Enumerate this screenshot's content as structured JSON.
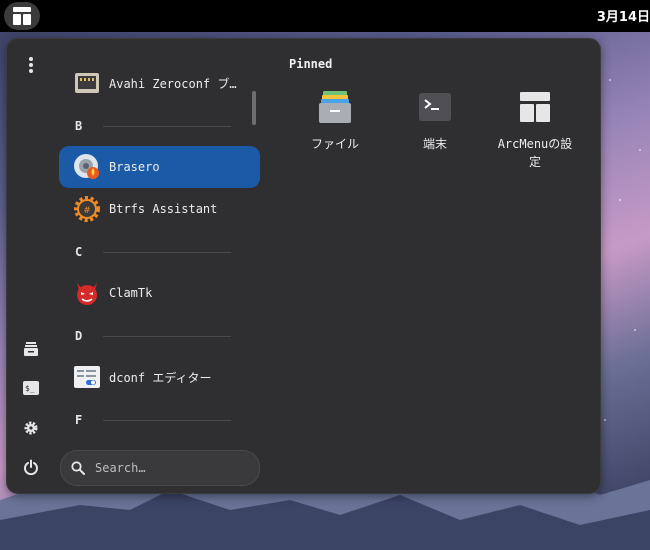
{
  "topbar": {
    "clock": "3月14日"
  },
  "menu": {
    "apps": [
      {
        "label": "Avahi Zeroconf ブ…",
        "icon": "network-device-icon"
      },
      {
        "section": "B"
      },
      {
        "label": "Brasero",
        "icon": "brasero-disc-icon",
        "selected": true
      },
      {
        "label": "Btrfs Assistant",
        "icon": "btrfs-gear-icon"
      },
      {
        "section": "C"
      },
      {
        "label": "ClamTk",
        "icon": "clamtk-devil-icon"
      },
      {
        "section": "D"
      },
      {
        "label": "dconf エディター",
        "icon": "dconf-editor-icon"
      },
      {
        "section": "F"
      }
    ],
    "search": {
      "placeholder": "Search…"
    },
    "pinned": {
      "title": "Pinned",
      "items": [
        {
          "label": "ファイル",
          "icon": "files-icon"
        },
        {
          "label": "端末",
          "icon": "terminal-icon"
        },
        {
          "label": "ArcMenuの設定",
          "icon": "arcmenu-settings-icon"
        }
      ]
    }
  }
}
